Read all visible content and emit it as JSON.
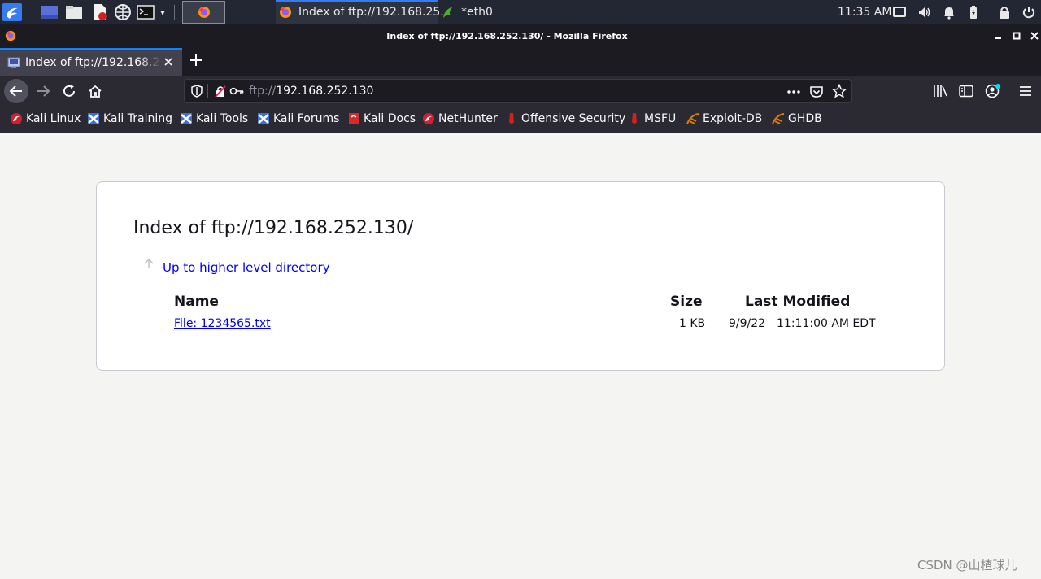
{
  "taskbar": {
    "tasks": [
      {
        "label": "Index of ftp://192.168.25..."
      },
      {
        "label": "*eth0"
      }
    ],
    "clock": "11:35 AM"
  },
  "window": {
    "title": "Index of ftp://192.168.252.130/ - Mozilla Firefox"
  },
  "tabs": [
    {
      "label": "Index of ftp://192.168.252.130/"
    }
  ],
  "urlbar": {
    "protocol": "ftp://",
    "host": "192.168.252.130"
  },
  "bookmarks": [
    {
      "label": "Kali Linux",
      "icon": "kali-dragon-icon",
      "color": "#cc2233"
    },
    {
      "label": "Kali Training",
      "icon": "kali-training-icon",
      "color": "#3d6fd6"
    },
    {
      "label": "Kali Tools",
      "icon": "kali-tools-icon",
      "color": "#3d6fd6"
    },
    {
      "label": "Kali Forums",
      "icon": "kali-forums-icon",
      "color": "#3d6fd6"
    },
    {
      "label": "Kali Docs",
      "icon": "kali-docs-icon",
      "color": "#d32b2b"
    },
    {
      "label": "NetHunter",
      "icon": "nethunter-icon",
      "color": "#cc2233"
    },
    {
      "label": "Offensive Security",
      "icon": "offsec-icon",
      "color": "#d02020"
    },
    {
      "label": "MSFU",
      "icon": "msfu-icon",
      "color": "#d02020"
    },
    {
      "label": "Exploit-DB",
      "icon": "exploit-db-icon",
      "color": "#e07b00"
    },
    {
      "label": "GHDB",
      "icon": "ghdb-icon",
      "color": "#e07b00"
    }
  ],
  "listing": {
    "heading": "Index of ftp://192.168.252.130/",
    "up_link": "Up to higher level directory",
    "columns": {
      "name": "Name",
      "size": "Size",
      "modified": "Last Modified"
    },
    "rows": [
      {
        "name": "File: 1234565.txt",
        "size": "1 KB",
        "date": "9/9/22",
        "time": "11:11:00 AM EDT"
      }
    ]
  },
  "watermark": "CSDN @山楂球儿"
}
